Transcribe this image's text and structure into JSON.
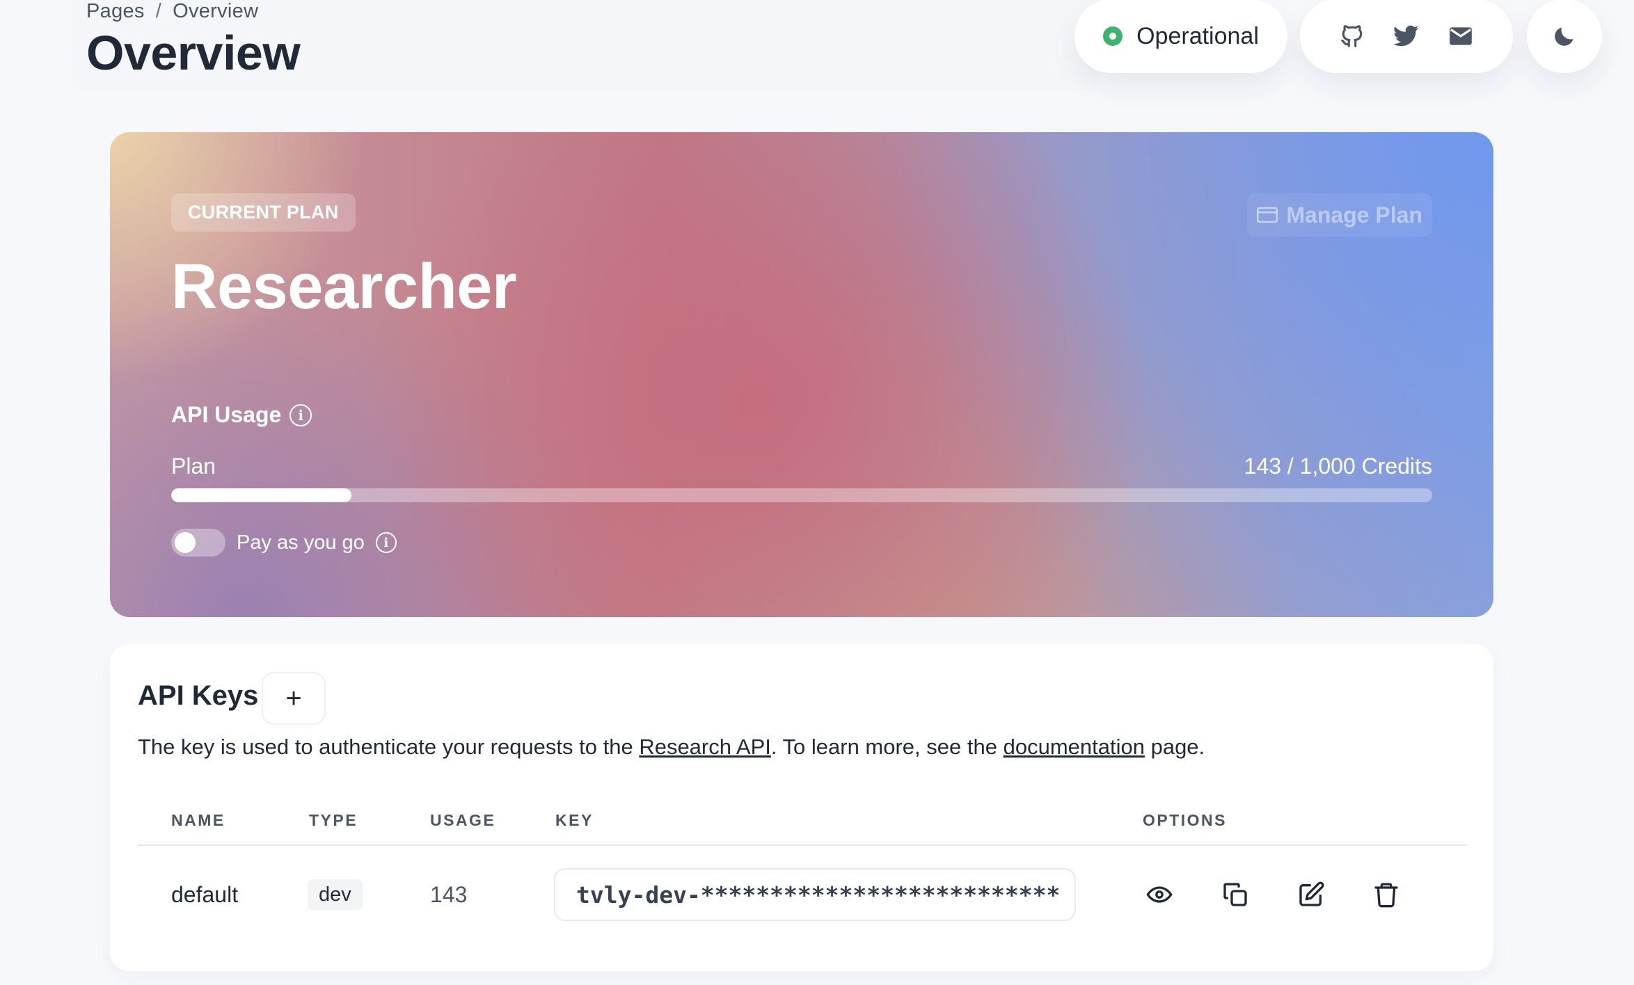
{
  "header": {
    "breadcrumb": {
      "root": "Pages",
      "separator": "/",
      "current": "Overview"
    },
    "title": "Overview",
    "status": {
      "label": "Operational",
      "color": "#3fb26f"
    },
    "social_icons": [
      "github-icon",
      "twitter-icon",
      "mail-icon"
    ],
    "theme_icon": "moon-icon"
  },
  "plan": {
    "badge": "CURRENT PLAN",
    "manage_label": "Manage Plan",
    "name": "Researcher",
    "usage_title": "API Usage",
    "plan_label": "Plan",
    "credits": "143 / 1,000 Credits",
    "used": 143,
    "total": 1000,
    "payg_label": "Pay as you go",
    "payg_enabled": false
  },
  "api_keys": {
    "title": "API Keys",
    "add_label": "+",
    "desc_prefix": "The key is used to authenticate your requests to the ",
    "desc_link1": "Research API",
    "desc_middle": ". To learn more, see the ",
    "desc_link2": "documentation",
    "desc_suffix": " page.",
    "columns": {
      "name": "NAME",
      "type": "TYPE",
      "usage": "USAGE",
      "key": "KEY",
      "options": "OPTIONS"
    },
    "rows": [
      {
        "name": "default",
        "type": "dev",
        "usage": "143",
        "key": "tvly-dev-**************************"
      }
    ],
    "option_icons": [
      "eye-icon",
      "copy-icon",
      "edit-icon",
      "trash-icon"
    ]
  }
}
